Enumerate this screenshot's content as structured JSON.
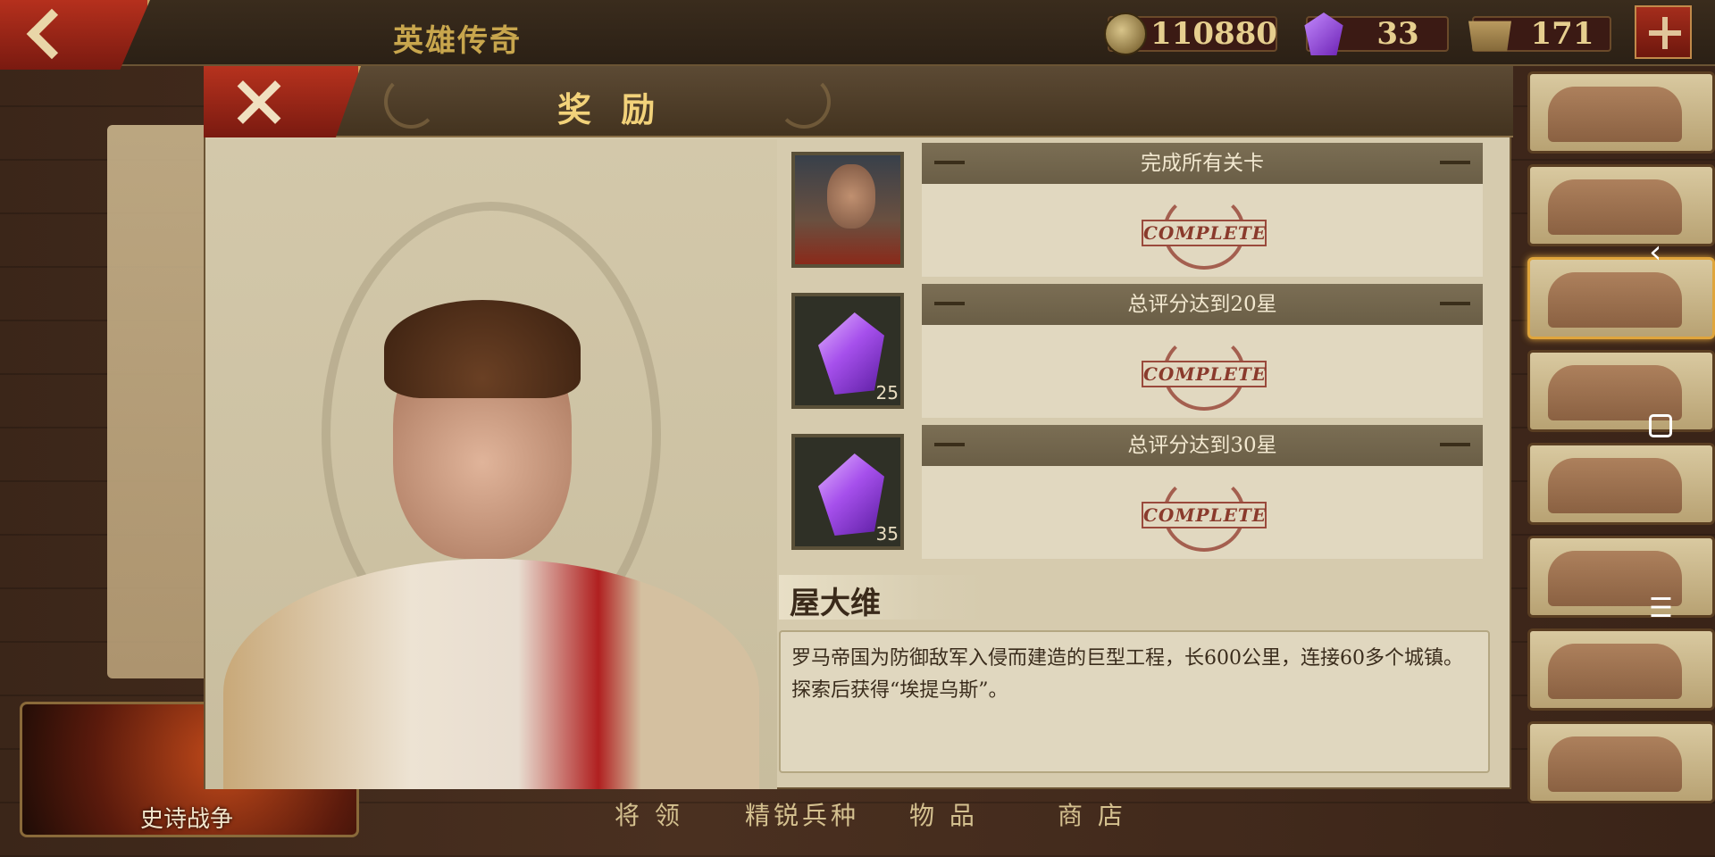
{
  "topbar": {
    "title": "英雄传奇",
    "coins": "110880",
    "gems": "33",
    "honor": "171",
    "coin_icon": "coin-icon",
    "gem_icon": "gem-icon",
    "honor_icon": "spqr-icon"
  },
  "dialog": {
    "title": "奖 励",
    "rewards": [
      {
        "task": "完成所有关卡",
        "reward_type": "hero-portrait",
        "count": "",
        "status": "COMPLETE"
      },
      {
        "task": "总评分达到20星",
        "reward_type": "gem",
        "count": "25",
        "status": "COMPLETE"
      },
      {
        "task": "总评分达到30星",
        "reward_type": "gem",
        "count": "35",
        "status": "COMPLETE"
      }
    ],
    "hero_name": "屋大维",
    "description": "罗马帝国为防御敌军入侵而建造的巨型工程，长600公里，连接60多个城镇。探索后获得“埃提乌斯”。"
  },
  "bottom_tabs": {
    "epic_war": "史诗战争",
    "generals": "将 领",
    "elite_troops": "精锐兵种",
    "items": "物 品",
    "shop": "商 店"
  },
  "colors": {
    "accent_red": "#b5301d",
    "gold_text": "#f2d27a",
    "stamp_red": "#9a4a3c",
    "gem_purple": "#a650ec"
  }
}
